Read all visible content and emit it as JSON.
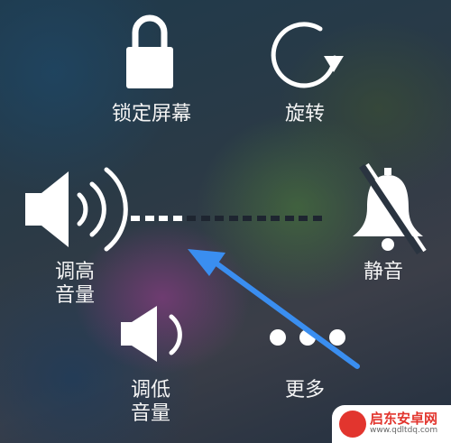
{
  "controls": {
    "lock": {
      "label": "锁定屏幕"
    },
    "rotate": {
      "label": "旋转"
    },
    "volume_up": {
      "label_line1": "调高",
      "label_line2": "音量"
    },
    "mute": {
      "label": "静音"
    },
    "volume_down": {
      "label_line1": "调低",
      "label_line2": "音量"
    },
    "more": {
      "label": "更多"
    }
  },
  "volume": {
    "level": 0.3,
    "segments": 14
  },
  "annotation": {
    "arrow_color": "#3a8ef0"
  },
  "watermark": {
    "title": "启东安卓网",
    "url": "www.qdltdq.com"
  }
}
